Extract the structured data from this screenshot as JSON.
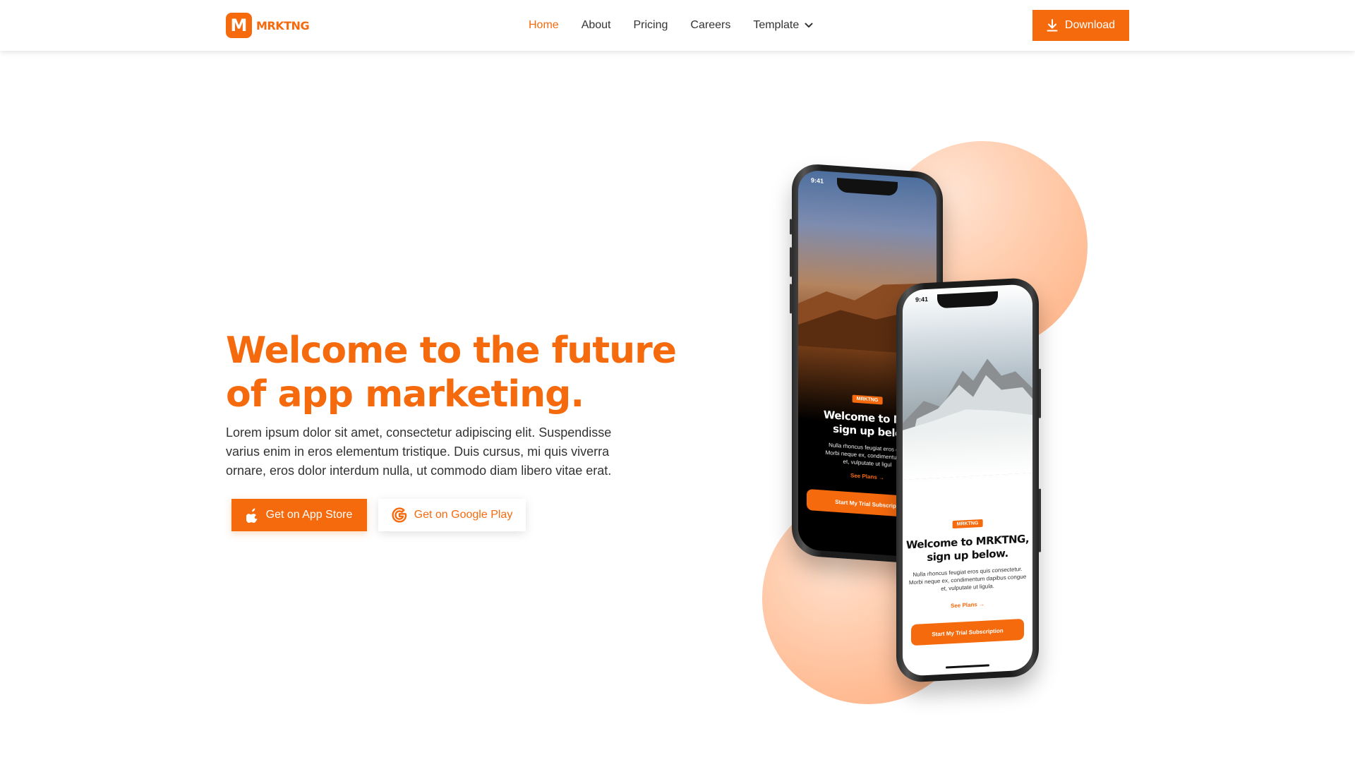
{
  "brand": {
    "logo_letter": "M",
    "name": "MRKTNG",
    "accent_color": "#f66a0e"
  },
  "nav": {
    "items": [
      {
        "label": "Home",
        "active": true
      },
      {
        "label": "About",
        "active": false
      },
      {
        "label": "Pricing",
        "active": false
      },
      {
        "label": "Careers",
        "active": false
      },
      {
        "label": "Template",
        "active": false,
        "has_dropdown": true
      }
    ],
    "download_label": "Download",
    "download_icon": "download-icon"
  },
  "hero": {
    "title_lines": [
      "Welcome to the future",
      "of app marketing."
    ],
    "body_lines": [
      "Lorem ipsum dolor sit amet, consectetur adipiscing elit. Suspendisse",
      "varius enim in eros elementum tristique. Duis cursus, mi quis viverra",
      "ornare, eros dolor interdum nulla, ut commodo diam libero vitae erat."
    ],
    "app_store": {
      "label": "Get on App Store",
      "icon": "apple-icon"
    },
    "google_play": {
      "label": "Get on Google Play",
      "icon": "google-icon"
    }
  },
  "phones": {
    "back": {
      "time": "9:41",
      "badge": "MRKTNG",
      "title_lines": [
        "Welcome to MR",
        "sign up belo"
      ],
      "text_lines": [
        "Nulla rhoncus feugiat eros quis",
        "Morbi neque ex, condimentum da",
        "et, vulputate ut ligul"
      ],
      "link": "See Plans →",
      "cta": "Start My Trial Subscripti"
    },
    "front": {
      "time": "9:41",
      "badge": "MRKTNG",
      "title_lines": [
        "Welcome to MRKTNG,",
        "sign up below."
      ],
      "text_lines": [
        "Nulla rhoncus feugiat eros quis consectetur.",
        "Morbi neque ex, condimentum dapibus congue",
        "et, vulputate ut ligula."
      ],
      "link": "See Plans →",
      "cta": "Start My Trial Subscription"
    }
  }
}
